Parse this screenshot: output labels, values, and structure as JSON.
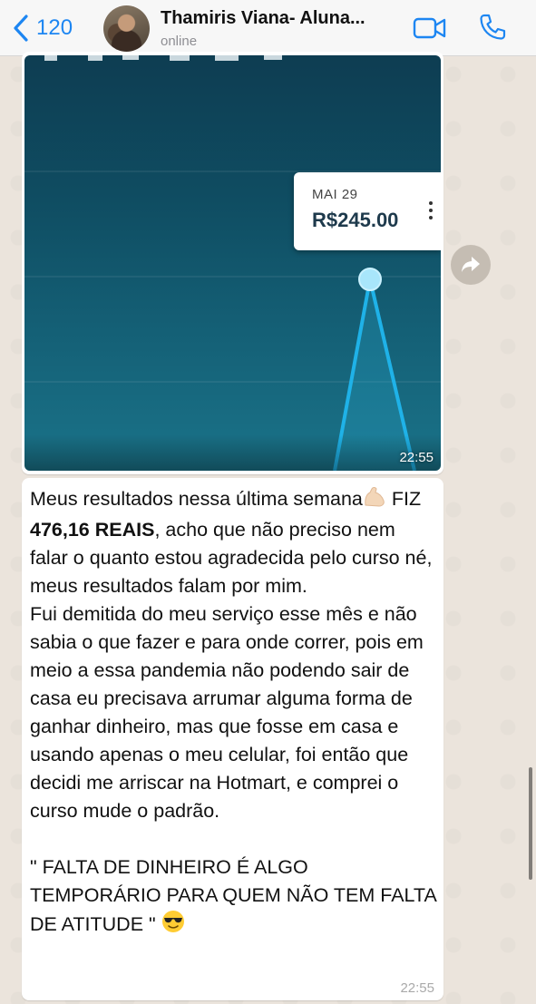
{
  "header": {
    "back_count": "120",
    "contact_name": "Thamiris Viana- Aluna...",
    "status": "online"
  },
  "image_message": {
    "tooltip_date": "MAI 29",
    "tooltip_value": "R$245.00",
    "time": "22:55"
  },
  "text_message": {
    "p1_a": "Meus resultados nessa última semana",
    "p1_b": " FIZ ",
    "p1_bold": "476,16 REAIS",
    "p1_c": ", acho que não preciso nem falar o quanto estou agradecida pelo curso né, meus resultados falam por mim.",
    "p2": "Fui demitida do meu serviço esse mês e não sabia o que fazer e para onde correr, pois em meio a essa pandemia não podendo sair de casa eu precisava arrumar alguma forma de ganhar dinheiro, mas que fosse em casa e usando apenas o meu celular, foi então que decidi me arriscar na Hotmart, e comprei o curso mude o padrão.",
    "p3": "\" FALTA DE DINHEIRO É ALGO TEMPORÁRIO PARA QUEM NÃO TEM FALTA DE ATITUDE \" ",
    "time": "22:55"
  },
  "icons": {
    "back": "chevron-left-icon",
    "video": "video-camera-icon",
    "call": "phone-icon",
    "forward": "forward-icon",
    "muscle": "flexed-biceps-emoji",
    "sunglasses": "sunglasses-emoji"
  },
  "colors": {
    "accent": "#1d86f2",
    "chart_bg": "#0f4d62",
    "chart_line": "#1fb2e8"
  }
}
